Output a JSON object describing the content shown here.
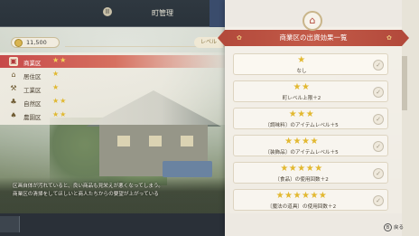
{
  "header": {
    "title": "町管理",
    "tab_glyph": "II"
  },
  "left_panel": {
    "money": "11,500",
    "level_tag": "レベル",
    "districts": [
      {
        "name": "商業区",
        "stars": "★★",
        "icon": "shop-icon",
        "selected": true
      },
      {
        "name": "居住区",
        "stars": "★",
        "icon": "house-icon",
        "selected": false
      },
      {
        "name": "工業区",
        "stars": "★",
        "icon": "hammer-icon",
        "selected": false
      },
      {
        "name": "自然区",
        "stars": "★★",
        "icon": "leaf-icon",
        "selected": false
      },
      {
        "name": "農園区",
        "stars": "★★",
        "icon": "sprout-icon",
        "selected": false
      }
    ],
    "description_line1": "区画自体が汚れていると、良い商品も見栄えが悪くなってしまう。",
    "description_line2": "商業区の清掃をしてほしいと商人たちからの要望が上がっている"
  },
  "popup": {
    "title": "商業区の出資効果一覧",
    "options": [
      {
        "stars": "★",
        "text": "なし"
      },
      {
        "stars": "★★",
        "text": "町レベル上限＋2"
      },
      {
        "stars": "★★★",
        "text": "〔調味料〕のアイテムレベル＋5"
      },
      {
        "stars": "★★★★",
        "text": "〔装飾品〕のアイテムレベル＋5"
      },
      {
        "stars": "★★★★★",
        "text": "〔食品〕の使用回数＋2"
      },
      {
        "stars": "★★★★★★",
        "text": "〔魔法の道具〕の使用回数＋2"
      }
    ],
    "check_glyph": "✓",
    "back_button_glyph": "B",
    "back_label": "戻る"
  },
  "colors": {
    "accent_red": "#b34a3c",
    "star_gold": "#e2b830",
    "panel_bg": "#f4f0e8"
  }
}
